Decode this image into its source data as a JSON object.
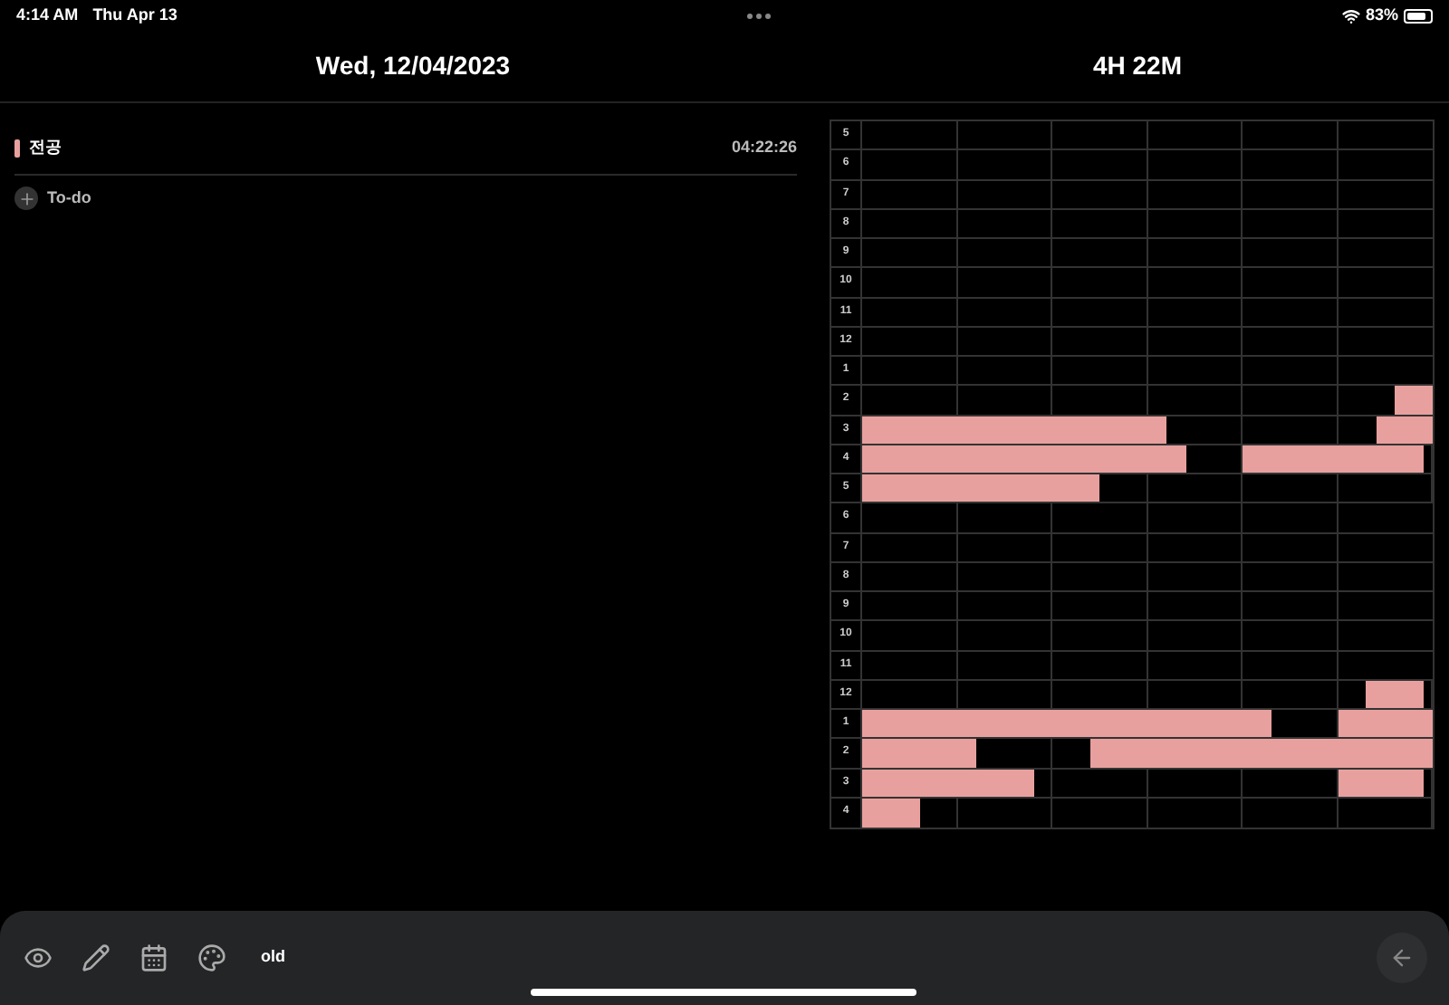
{
  "status_bar": {
    "time": "4:14 AM",
    "date": "Thu Apr 13",
    "battery": "83%"
  },
  "header": {
    "date": "Wed, 12/04/2023",
    "total": "4H 22M"
  },
  "subjects": [
    {
      "name": "전공",
      "time": "04:22:26",
      "color": "#e8a09e"
    }
  ],
  "add_todo": {
    "label": "To-do"
  },
  "timetable": {
    "hours": [
      "5",
      "6",
      "7",
      "8",
      "9",
      "10",
      "11",
      "12",
      "1",
      "2",
      "3",
      "4",
      "5",
      "6",
      "7",
      "8",
      "9",
      "10",
      "11",
      "12",
      "1",
      "2",
      "3",
      "4"
    ]
  },
  "toolbar": {
    "items": [
      {
        "kind": "eye"
      },
      {
        "kind": "pencil"
      },
      {
        "kind": "calendar"
      },
      {
        "kind": "palette"
      }
    ],
    "label": "old"
  }
}
